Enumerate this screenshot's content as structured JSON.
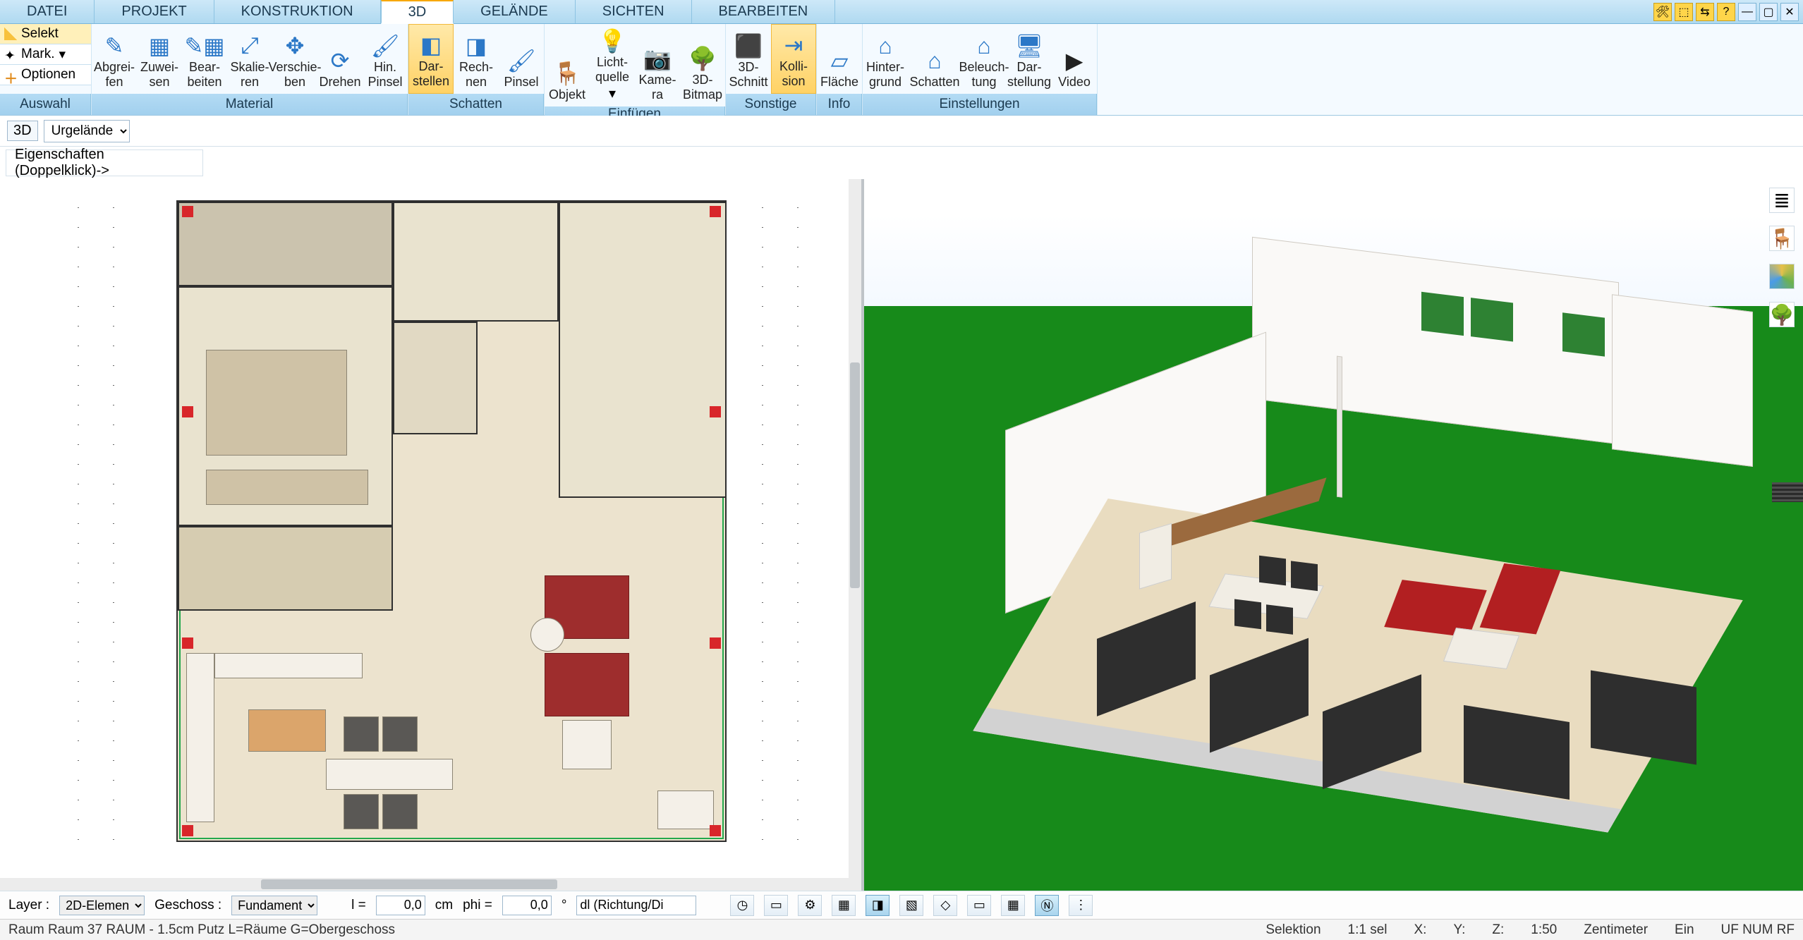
{
  "tabs": {
    "t0": "DATEI",
    "t1": "PROJEKT",
    "t2": "KONSTRUKTION",
    "t3": "3D",
    "t4": "GELÄNDE",
    "t5": "SICHTEN",
    "t6": "BEARBEITEN"
  },
  "auswahl": {
    "selekt": "Selekt",
    "mark": "Mark.",
    "optionen": "Optionen",
    "group": "Auswahl"
  },
  "ribbon": {
    "material": {
      "label": "Material",
      "b0": "Abgrei-\nfen",
      "b1": "Zuwei-\nsen",
      "b2": "Bear-\nbeiten",
      "b3": "Skalie-\nren",
      "b4": "Verschie-\nben",
      "b5": "Drehen",
      "b6": "Hin.\nPinsel"
    },
    "schatten": {
      "label": "Schatten",
      "b0": "Dar-\nstellen",
      "b1": "Rech-\nnen",
      "b2": "Pinsel"
    },
    "einfuegen": {
      "label": "Einfügen",
      "b0": "Objekt",
      "b1": "Licht-\nquelle",
      "b2": "Kame-\nra",
      "b3": "3D-\nBitmap"
    },
    "sonstige": {
      "label": "Sonstige",
      "b0": "3D-\nSchnitt",
      "b1": "Kolli-\nsion"
    },
    "info": {
      "label": "Info",
      "b0": "Fläche"
    },
    "einstellungen": {
      "label": "Einstellungen",
      "b0": "Hinter-\ngrund",
      "b1": "Schatten",
      "b2": "Beleuch-\ntung",
      "b3": "Dar-\nstellung",
      "b4": "Video"
    }
  },
  "subbar": {
    "mode": "3D",
    "dropdown": "Urgelände"
  },
  "propbar": {
    "text": "Eigenschaften (Doppelklick)->"
  },
  "bottom": {
    "layer_lbl": "Layer :",
    "layer_val": "2D-Elemen",
    "geschoss_lbl": "Geschoss :",
    "geschoss_val": "Fundament",
    "l_lbl": "l =",
    "l_val": "0,0",
    "cm": "cm",
    "phi_lbl": "phi =",
    "phi_val": "0,0",
    "deg": "°",
    "richtung": "dl (Richtung/Di"
  },
  "status": {
    "left": "Raum Raum 37 RAUM - 1.5cm Putz L=Räume G=Obergeschoss",
    "sel": "Selektion",
    "ratio": "1:1 sel",
    "x": "X:",
    "y": "Y:",
    "z": "Z:",
    "scale": "1:50",
    "unit": "Zentimeter",
    "ein": "Ein",
    "caps": "UF NUM RF"
  },
  "righttools": {
    "t0": "layers-icon",
    "t1": "chair-icon",
    "t2": "palette-icon",
    "t3": "tree-icon"
  }
}
